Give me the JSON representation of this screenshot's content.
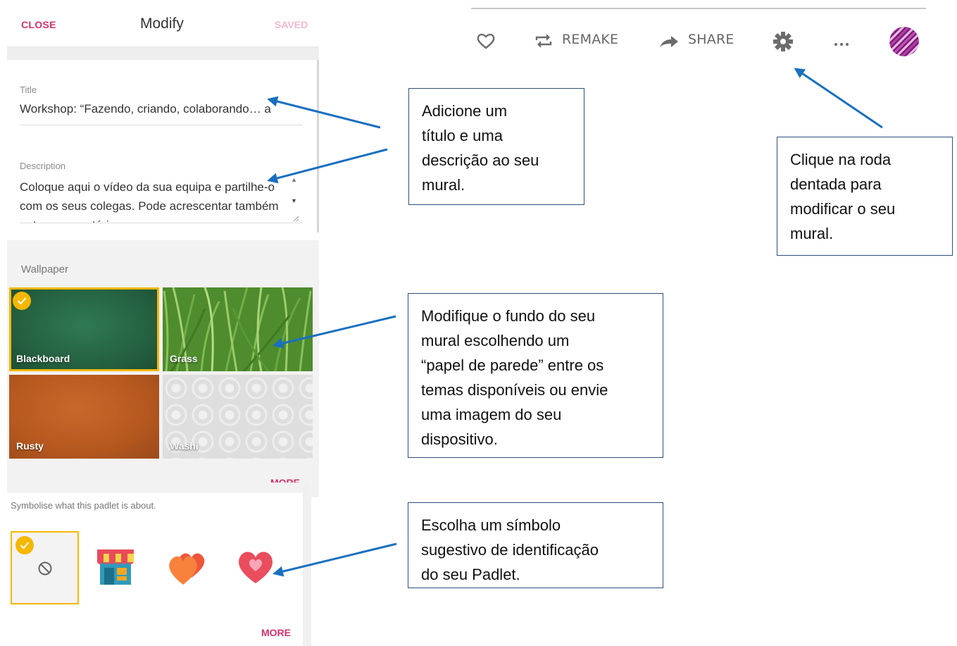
{
  "panel": {
    "close_label": "CLOSE",
    "title": "Modify",
    "saved_label": "SAVED",
    "title_field": {
      "label": "Title",
      "value": "Workshop: “Fazendo, criando, colaborando… a"
    },
    "description_field": {
      "label": "Description",
      "value": "Coloque aqui o vídeo da sua equipa e partilhe-o com os seus colegas. Pode acrescentar também outros comentários."
    },
    "wallpaper": {
      "label": "Wallpaper",
      "options": [
        {
          "name": "Blackboard",
          "selected": true
        },
        {
          "name": "Grass",
          "selected": false
        },
        {
          "name": "Rusty",
          "selected": false
        },
        {
          "name": "Washi",
          "selected": false
        }
      ],
      "more_label": "MORE"
    },
    "symbol": {
      "prompt": "Symbolise what this padlet is about.",
      "options": [
        "no-symbol-icon",
        "shop-icon",
        "two-hearts-icon",
        "heart-icon"
      ],
      "selected": "no-symbol-icon",
      "more_label": "MORE"
    }
  },
  "toolbar": {
    "like_icon": "heart-outline-icon",
    "remake_label": "REMAKE",
    "share_label": "SHARE",
    "settings_icon": "gear-icon",
    "more_icon": "ellipsis-icon",
    "avatar_icon": "avatar"
  },
  "callouts": {
    "title": "Adicione um\ntítulo e uma\ndescrição ao seu\nmural.",
    "gear": "Clique na roda\ndentada para\nmodificar o seu\nmural.",
    "wallpaper": "Modifique o fundo do seu\nmural escolhendo um\n“papel de parede” entre os\ntemas disponíveis ou envie\numa imagem do seu\ndispositivo.",
    "symbol": "Escolha um símbolo\nsugestivo de identificação\ndo seu Padlet."
  },
  "colors": {
    "accent_pink": "#d4326d",
    "selection_yellow": "#f5b700",
    "arrow_blue": "#1a6fc0"
  }
}
